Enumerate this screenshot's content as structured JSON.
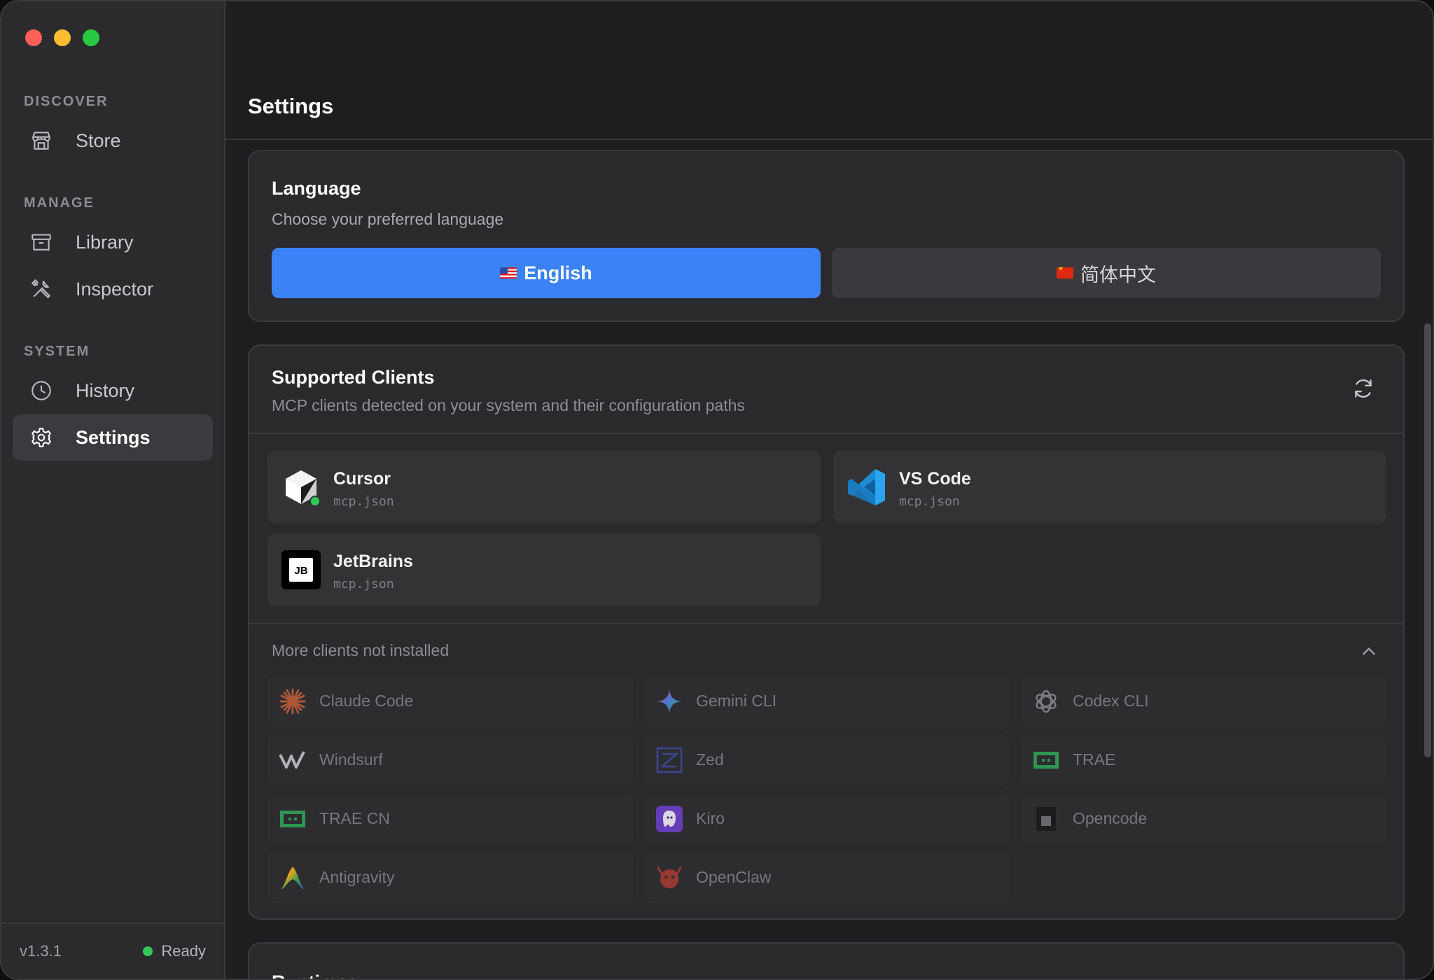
{
  "sidebar": {
    "sections": [
      {
        "label": "DISCOVER",
        "items": [
          {
            "label": "Store",
            "icon": "store-icon"
          }
        ]
      },
      {
        "label": "MANAGE",
        "items": [
          {
            "label": "Library",
            "icon": "archive-icon"
          },
          {
            "label": "Inspector",
            "icon": "tools-icon"
          }
        ]
      },
      {
        "label": "SYSTEM",
        "items": [
          {
            "label": "History",
            "icon": "clock-icon"
          },
          {
            "label": "Settings",
            "icon": "gear-icon",
            "active": true
          }
        ]
      }
    ],
    "version": "v1.3.1",
    "status": "Ready",
    "status_color": "#35c759"
  },
  "header": {
    "title": "Settings"
  },
  "language": {
    "title": "Language",
    "subtitle": "Choose your preferred language",
    "options": [
      {
        "label": "English",
        "flag": "us-flag",
        "selected": true
      },
      {
        "label": "简体中文",
        "flag": "cn-flag",
        "selected": false
      }
    ],
    "accent": "#3b82f6"
  },
  "clients": {
    "title": "Supported Clients",
    "subtitle": "MCP clients detected on your system and their configuration paths",
    "installed": [
      {
        "name": "Cursor",
        "path": "mcp.json",
        "icon": "cursor-icon"
      },
      {
        "name": "VS Code",
        "path": "mcp.json",
        "icon": "vscode-icon"
      },
      {
        "name": "JetBrains",
        "path": "mcp.json",
        "icon": "jetbrains-icon"
      }
    ],
    "more_label": "More clients not installed",
    "not_installed": [
      {
        "name": "Claude Code",
        "icon": "claude-icon"
      },
      {
        "name": "Gemini CLI",
        "icon": "gemini-icon"
      },
      {
        "name": "Codex CLI",
        "icon": "openai-icon"
      },
      {
        "name": "Windsurf",
        "icon": "windsurf-icon"
      },
      {
        "name": "Zed",
        "icon": "zed-icon"
      },
      {
        "name": "TRAE",
        "icon": "trae-icon"
      },
      {
        "name": "TRAE CN",
        "icon": "trae-icon"
      },
      {
        "name": "Kiro",
        "icon": "kiro-icon"
      },
      {
        "name": "Opencode",
        "icon": "opencode-icon"
      },
      {
        "name": "Antigravity",
        "icon": "antigravity-icon"
      },
      {
        "name": "OpenClaw",
        "icon": "openclaw-icon"
      }
    ]
  },
  "runtimes": {
    "title": "Runtimes"
  }
}
